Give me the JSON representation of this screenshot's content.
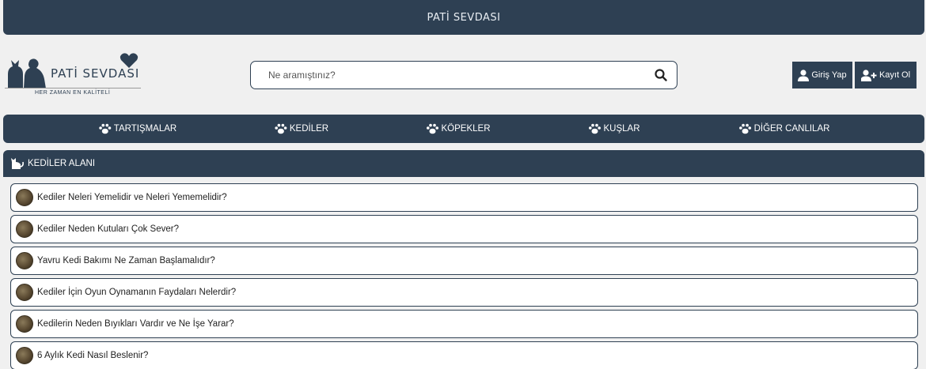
{
  "topbar": {
    "title": "PATİ SEVDASI"
  },
  "logo": {
    "name": "PATİ SEVDASI",
    "tagline": "HER ZAMAN EN KALİTELİ"
  },
  "search": {
    "placeholder": "Ne aramıştınız?",
    "icon": "search-icon"
  },
  "auth": {
    "login_label": "Giriş Yap",
    "register_label": "Kayıt Ol"
  },
  "nav": {
    "items": [
      {
        "label": "TARTIŞMALAR",
        "icon": "paw-icon"
      },
      {
        "label": "KEDİLER",
        "icon": "paw-icon"
      },
      {
        "label": "KÖPEKLER",
        "icon": "paw-icon"
      },
      {
        "label": "KUŞLAR",
        "icon": "paw-icon"
      },
      {
        "label": "DİĞER CANLILAR",
        "icon": "paw-icon"
      }
    ]
  },
  "section": {
    "title": "KEDİLER ALANI",
    "icon": "cat-icon"
  },
  "topics": [
    {
      "title": "Kediler Neleri Yemelidir ve Neleri Yememelidir?"
    },
    {
      "title": "Kediler Neden Kutuları Çok Sever?"
    },
    {
      "title": "Yavru Kedi Bakımı Ne Zaman Başlamalıdır?"
    },
    {
      "title": "Kediler İçin Oyun Oynamanın Faydaları Nelerdir?"
    },
    {
      "title": "Kedilerin Neden Bıyıkları Vardır ve Ne İşe Yarar?"
    },
    {
      "title": "6 Aylık Kedi Nasıl Beslenir?"
    }
  ],
  "colors": {
    "primary": "#2e4053",
    "background": "#f0f0f0",
    "card": "#ffffff"
  }
}
